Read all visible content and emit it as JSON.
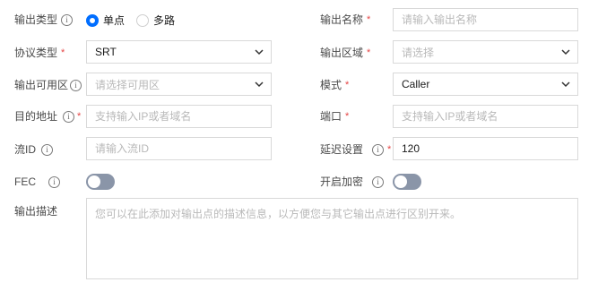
{
  "left": {
    "output_type": {
      "label": "输出类型",
      "options": [
        {
          "label": "单点",
          "selected": true
        },
        {
          "label": "多路",
          "selected": false
        }
      ]
    },
    "protocol": {
      "label": "协议类型",
      "required": "*",
      "value": "SRT"
    },
    "output_zone": {
      "label": "输出可用区",
      "placeholder": "请选择可用区"
    },
    "dest_address": {
      "label": "目的地址",
      "required": "*",
      "placeholder": "支持输入IP或者域名"
    },
    "stream_id": {
      "label": "流ID",
      "placeholder": "请输入流ID"
    },
    "fec": {
      "label": "FEC",
      "enabled": false
    }
  },
  "right": {
    "output_name": {
      "label": "输出名称",
      "required": "*",
      "placeholder": "请输入输出名称"
    },
    "output_region": {
      "label": "输出区域",
      "required": "*",
      "placeholder": "请选择"
    },
    "mode": {
      "label": "模式",
      "required": "*",
      "value": "Caller"
    },
    "port": {
      "label": "端口",
      "required": "*",
      "placeholder": "支持输入IP或者域名"
    },
    "latency": {
      "label": "延迟设置",
      "required": "*",
      "value": "120"
    },
    "encryption": {
      "label": "开启加密",
      "enabled": false
    }
  },
  "description": {
    "label": "输出描述",
    "placeholder": "您可以在此添加对输出点的描述信息，以方便您与其它输出点进行区别开来。"
  },
  "icons": {
    "info": "i",
    "info_icon_name": "info-circle-icon",
    "chevron_icon_name": "chevron-down-icon"
  },
  "colors": {
    "accent": "#006eff",
    "required": "#e54545",
    "toggle_off": "#8a95a8"
  }
}
